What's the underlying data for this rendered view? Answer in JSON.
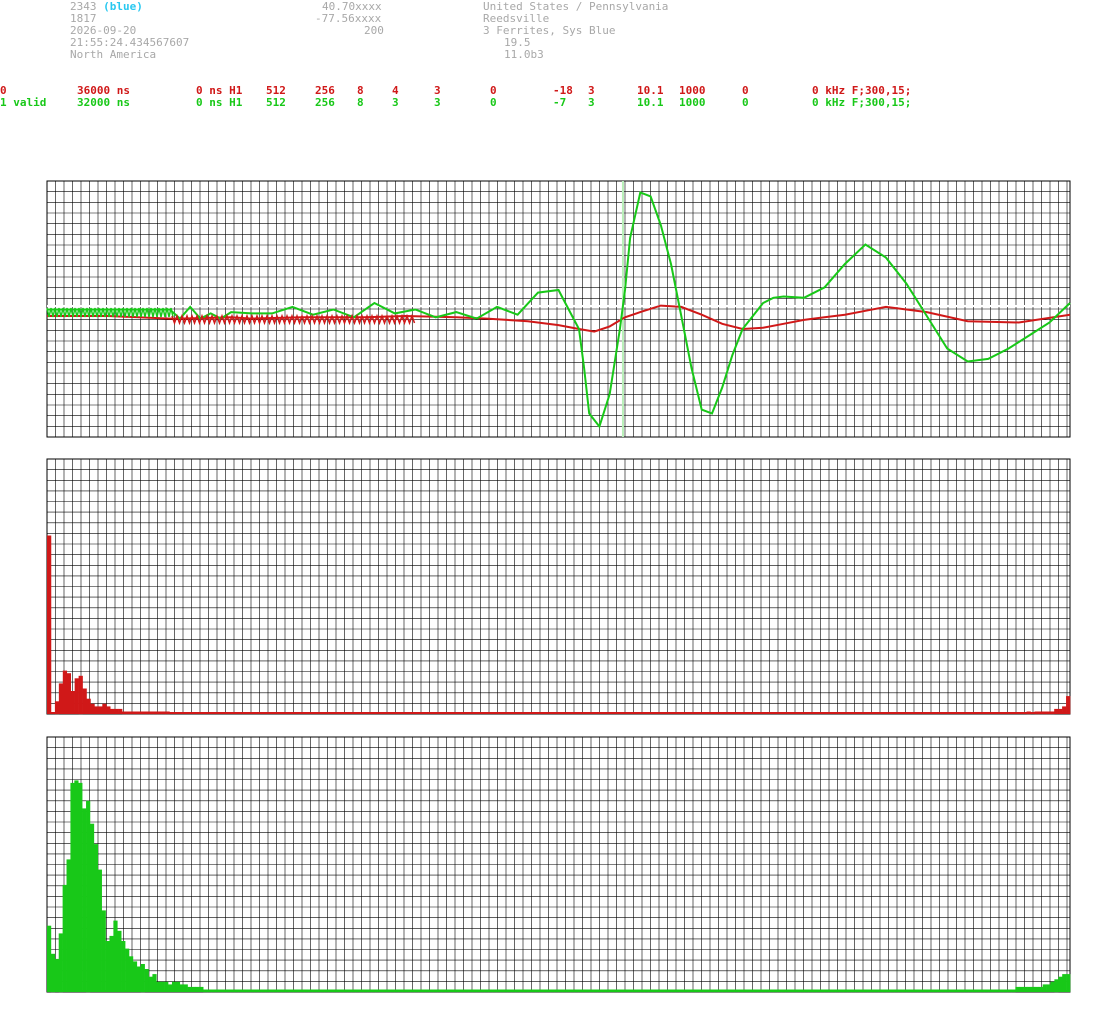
{
  "station": {
    "id": "2343",
    "id_color": "(blue)",
    "number": "1817",
    "date": "2026-09-20",
    "time": "21:55:24.434567607",
    "continent": "North America",
    "lat": "40.70xxxx",
    "lon": "-77.56xxxx",
    "alt": "200",
    "country": "United States / Pennsylvania",
    "city": "Reedsville",
    "antenna": "3 Ferrites, Sys Blue",
    "value1": "19.5",
    "version": "11.0b3"
  },
  "channels": [
    {
      "c0": "0",
      "c1": "36000 ns",
      "c2": "0 ns H1",
      "c3": "512",
      "c4": "256",
      "c5": "8",
      "c6": "4",
      "c7": "3",
      "c8": "0",
      "c9": "-18",
      "c10": "3",
      "c11": "10.1",
      "c12": "1000",
      "c13": "0",
      "c14": "0 kHz F;300,15;"
    },
    {
      "c0": "1 valid",
      "c1": "32000 ns",
      "c2": "0 ns H1",
      "c3": "512",
      "c4": "256",
      "c5": "8",
      "c6": "3",
      "c7": "3",
      "c8": "0",
      "c9": "-7",
      "c10": "3",
      "c11": "10.1",
      "c12": "1000",
      "c13": "0",
      "c14": "0 kHz F;300,15;"
    }
  ],
  "colors": {
    "ch0": "#d01818",
    "ch1": "#18c818",
    "grid": "#000000",
    "marker": "#b8f0b8",
    "header": "#a8a8a8",
    "blue_label": "#28c8f0"
  },
  "chart_data": [
    {
      "type": "line",
      "title": "",
      "xlabel": "",
      "ylabel": "",
      "xlim": [
        0,
        1000
      ],
      "ylim": [
        -100,
        100
      ],
      "grid": true,
      "marker_x": 563,
      "series": [
        {
          "x": [
            0,
            60,
            120,
            130,
            180,
            200,
            250,
            310,
            350,
            400,
            430,
            470,
            500,
            520,
            535,
            550,
            565,
            580,
            600,
            620,
            640,
            660,
            680,
            700,
            720,
            740,
            760,
            780,
            800,
            820,
            860,
            900,
            950,
            1000
          ],
          "y": [
            0,
            0,
            -2,
            -2,
            -1,
            -2,
            -1,
            -1,
            0,
            -1,
            -2,
            -4,
            -7,
            -10,
            -12,
            -8,
            -1,
            3,
            8,
            7,
            1,
            -6,
            -10,
            -9,
            -6,
            -3,
            -1,
            1,
            4,
            7,
            3,
            -4,
            -5,
            1
          ]
        },
        {
          "x": [
            0,
            60,
            120,
            130,
            140,
            150,
            160,
            170,
            180,
            200,
            220,
            240,
            260,
            280,
            300,
            320,
            340,
            360,
            380,
            400,
            420,
            440,
            460,
            480,
            500,
            510,
            520,
            525,
            530,
            540,
            550,
            560,
            565,
            570,
            580,
            590,
            600,
            610,
            620,
            630,
            640,
            650,
            660,
            670,
            680,
            700,
            710,
            720,
            740,
            760,
            780,
            800,
            820,
            840,
            860,
            880,
            900,
            920,
            940,
            960,
            980,
            1000
          ],
          "y": [
            5,
            5,
            5,
            -2,
            7,
            -2,
            2,
            -2,
            3,
            2,
            2,
            7,
            1,
            5,
            -1,
            10,
            2,
            5,
            -1,
            3,
            -2,
            7,
            1,
            18,
            20,
            5,
            -10,
            -40,
            -75,
            -85,
            -60,
            -10,
            20,
            60,
            95,
            92,
            70,
            40,
            0,
            -40,
            -72,
            -75,
            -55,
            -30,
            -10,
            10,
            14,
            15,
            14,
            22,
            40,
            55,
            45,
            25,
            0,
            -25,
            -35,
            -33,
            -25,
            -15,
            -5,
            10
          ]
        }
      ]
    },
    {
      "type": "bar",
      "title": "",
      "xlabel": "",
      "ylabel": "",
      "ylim": [
        0,
        100
      ],
      "grid": true,
      "values": [
        70,
        0,
        5,
        12,
        17,
        16,
        9,
        14,
        15,
        10,
        6,
        4,
        3,
        3,
        4,
        3,
        2,
        2,
        2,
        1,
        1,
        1,
        1,
        1,
        1,
        1,
        1,
        1,
        1,
        1,
        1,
        0,
        0,
        0,
        0,
        0,
        0,
        0,
        0,
        0,
        0,
        0,
        0,
        0,
        0,
        0,
        0,
        0,
        0,
        0,
        0,
        0,
        0,
        0,
        0,
        0,
        0,
        0,
        0,
        0,
        0,
        0,
        0,
        0,
        0,
        0,
        0,
        0,
        0,
        0,
        0,
        0,
        0,
        0,
        0,
        0,
        0,
        0,
        0,
        0,
        0,
        0,
        0,
        0,
        0,
        0,
        0,
        0,
        0,
        0,
        0,
        0,
        0,
        0,
        0,
        0,
        0,
        0,
        0,
        0,
        0,
        0,
        0,
        0,
        0,
        0,
        0,
        0,
        0,
        0,
        0,
        0,
        0,
        0,
        0,
        0,
        0,
        0,
        0,
        0,
        0,
        0,
        0,
        0,
        0,
        0,
        0,
        0,
        0,
        0,
        0,
        0,
        0,
        0,
        0,
        0,
        0,
        0,
        0,
        0,
        0,
        0,
        0,
        0,
        0,
        0,
        0,
        0,
        0,
        0,
        0,
        0,
        0,
        0,
        0,
        0,
        0,
        0,
        0,
        0,
        0,
        0,
        0,
        0,
        0,
        0,
        0,
        0,
        0,
        0,
        0,
        0,
        0,
        0,
        0,
        0,
        0,
        0,
        0,
        0,
        0,
        0,
        0,
        0,
        0,
        0,
        0,
        0,
        0,
        0,
        0,
        0,
        0,
        0,
        0,
        0,
        0,
        0,
        0,
        0,
        0,
        0,
        0,
        0,
        0,
        0,
        0,
        0,
        0,
        0,
        0,
        0,
        0,
        0,
        0,
        0,
        0,
        0,
        0,
        0,
        0,
        0,
        0,
        0,
        0,
        0,
        0,
        0,
        0,
        0,
        0,
        0,
        0,
        0,
        0,
        0,
        0,
        0,
        0,
        0,
        0,
        0,
        0,
        0,
        0,
        0,
        0,
        0,
        1,
        0,
        1,
        1,
        1,
        1,
        1,
        2,
        2,
        3,
        7
      ]
    },
    {
      "type": "bar",
      "title": "",
      "xlabel": "",
      "ylabel": "",
      "ylim": [
        0,
        100
      ],
      "grid": true,
      "values": [
        26,
        15,
        13,
        23,
        42,
        52,
        82,
        83,
        82,
        72,
        75,
        66,
        58,
        48,
        32,
        20,
        22,
        28,
        24,
        20,
        17,
        14,
        12,
        10,
        11,
        9,
        6,
        7,
        4,
        4,
        4,
        3,
        4,
        4,
        3,
        3,
        2,
        2,
        2,
        2,
        1,
        1,
        1,
        1,
        1,
        1,
        1,
        1,
        1,
        1,
        1,
        1,
        1,
        1,
        1,
        1,
        1,
        1,
        1,
        1,
        1,
        1,
        1,
        1,
        1,
        1,
        1,
        1,
        1,
        1,
        1,
        1,
        1,
        1,
        1,
        1,
        1,
        1,
        1,
        1,
        1,
        1,
        1,
        1,
        1,
        1,
        1,
        1,
        1,
        1,
        1,
        1,
        1,
        1,
        1,
        1,
        1,
        1,
        1,
        1,
        1,
        1,
        1,
        1,
        1,
        1,
        1,
        1,
        1,
        1,
        1,
        1,
        1,
        1,
        1,
        1,
        1,
        1,
        1,
        1,
        1,
        1,
        1,
        1,
        1,
        1,
        1,
        1,
        1,
        1,
        1,
        1,
        1,
        1,
        1,
        1,
        1,
        1,
        1,
        1,
        1,
        1,
        1,
        1,
        1,
        1,
        1,
        1,
        1,
        1,
        1,
        1,
        1,
        1,
        1,
        1,
        1,
        1,
        1,
        1,
        1,
        1,
        1,
        1,
        1,
        1,
        1,
        1,
        1,
        1,
        1,
        1,
        1,
        1,
        1,
        1,
        1,
        1,
        1,
        1,
        1,
        1,
        1,
        1,
        1,
        1,
        1,
        1,
        1,
        1,
        1,
        1,
        1,
        1,
        1,
        1,
        1,
        1,
        1,
        1,
        1,
        1,
        1,
        1,
        1,
        1,
        1,
        1,
        1,
        1,
        1,
        1,
        1,
        1,
        1,
        1,
        1,
        1,
        1,
        1,
        1,
        1,
        1,
        1,
        1,
        1,
        1,
        1,
        1,
        1,
        1,
        1,
        1,
        1,
        1,
        1,
        1,
        1,
        1,
        1,
        1,
        1,
        1,
        1,
        1,
        1,
        1,
        1,
        2,
        2,
        2,
        2,
        2,
        2,
        2,
        3,
        3,
        4,
        5,
        6,
        7,
        7
      ]
    }
  ]
}
